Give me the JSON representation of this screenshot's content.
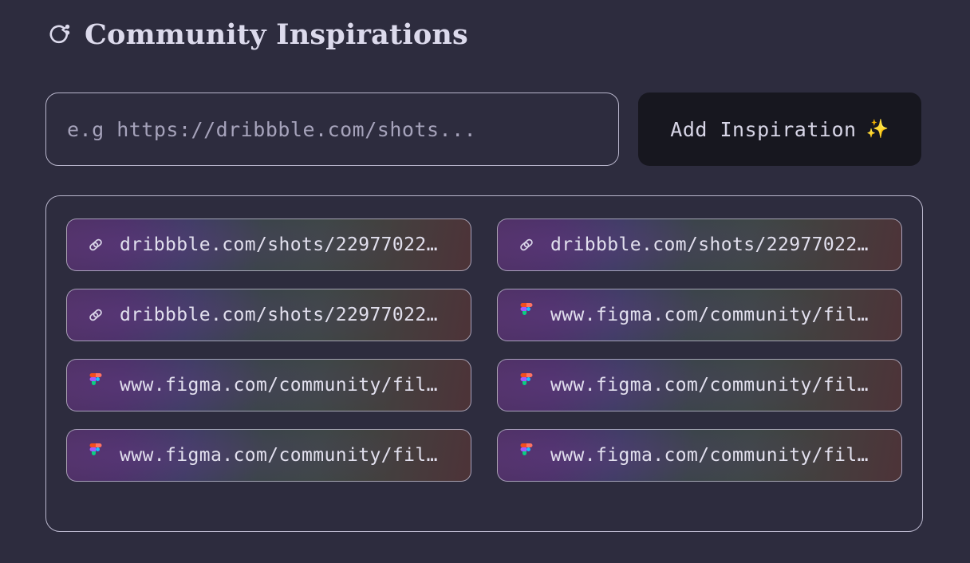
{
  "theme": {
    "background": "#2d2c3e",
    "border": "#b9b6cc",
    "text": "#dcdaec",
    "button_bg": "#17171f",
    "sparkle": "#e8b63a",
    "card_gradient_start": "#4a2f5e",
    "card_gradient_mid": "#33453f",
    "card_gradient_end": "#4d3338"
  },
  "header": {
    "title": "Community Inspirations",
    "icon": "share-loop-icon"
  },
  "form": {
    "input": {
      "placeholder": "e.g https://dribbble.com/shots...",
      "value": "",
      "name": "inspiration-url-input"
    },
    "add_button": {
      "label": "Add Inspiration",
      "sparkle": "✨",
      "name": "add-inspiration-button"
    }
  },
  "list": {
    "items": [
      {
        "icon": "link-icon",
        "label": "dribbble.com/shots/22977022…"
      },
      {
        "icon": "link-icon",
        "label": "dribbble.com/shots/22977022…"
      },
      {
        "icon": "link-icon",
        "label": "dribbble.com/shots/22977022…"
      },
      {
        "icon": "figma-icon",
        "label": "www.figma.com/community/fil…"
      },
      {
        "icon": "figma-icon",
        "label": "www.figma.com/community/fil…"
      },
      {
        "icon": "figma-icon",
        "label": "www.figma.com/community/fil…"
      },
      {
        "icon": "figma-icon",
        "label": "www.figma.com/community/fil…"
      },
      {
        "icon": "figma-icon",
        "label": "www.figma.com/community/fil…"
      }
    ]
  }
}
